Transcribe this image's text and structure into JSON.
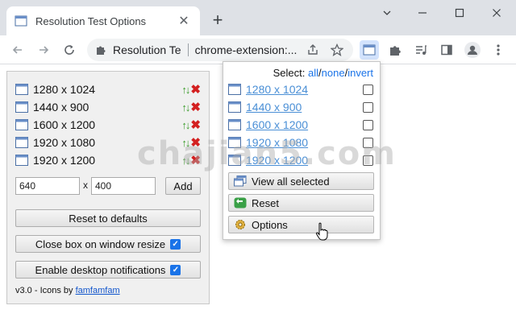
{
  "tab": {
    "title": "Resolution Test Options",
    "favicon": "window-icon",
    "close": "✕"
  },
  "toolbar": {
    "omnibox_site": "Resolution Te",
    "omnibox_url": "chrome-extension:...",
    "new_tab": "+"
  },
  "options": {
    "resolutions": [
      {
        "label": "1280 x 1024"
      },
      {
        "label": "1440 x 900"
      },
      {
        "label": "1600 x 1200"
      },
      {
        "label": "1920 x 1080"
      },
      {
        "label": "1920 x 1200"
      }
    ],
    "width_value": "640",
    "x_label": "x",
    "height_value": "400",
    "add_label": "Add",
    "reset_label": "Reset to defaults",
    "close_box_label": "Close box on window resize",
    "close_box_checked": true,
    "notifications_label": "Enable desktop notifications",
    "notifications_checked": true,
    "footer_prefix": "v3.0 - Icons by ",
    "footer_link": "famfamfam"
  },
  "popup": {
    "select_label": "Select:",
    "select_all": "all",
    "select_none": "none",
    "select_invert": "invert",
    "slash": "/",
    "resolutions": [
      {
        "label": "1280 x 1024",
        "checked": false
      },
      {
        "label": "1440 x 900",
        "checked": false
      },
      {
        "label": "1600 x 1200",
        "checked": false
      },
      {
        "label": "1920 x 1080",
        "checked": false
      },
      {
        "label": "1920 x 1200",
        "checked": false
      }
    ],
    "view_all_label": "View all selected",
    "reset_label": "Reset",
    "options_label": "Options"
  },
  "watermark": "chajian5.com",
  "colors": {
    "accent": "#1a73e8",
    "link": "#4a8fd6",
    "green_arrow": "#3a9c2b",
    "red_x": "#d32020"
  }
}
